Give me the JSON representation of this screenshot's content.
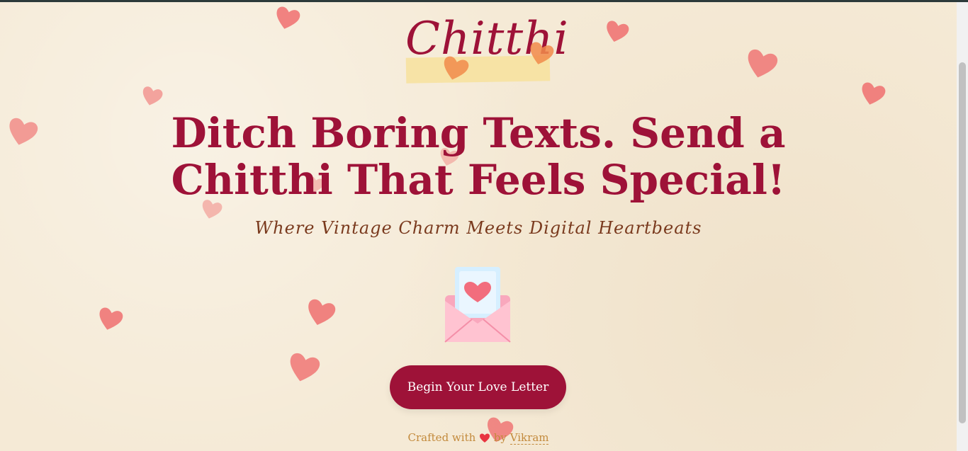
{
  "brand": {
    "name": "Chitthi"
  },
  "hero": {
    "headline_line1": "Ditch Boring Texts. Send a",
    "headline_line2": "Chitthi That Feels Special!",
    "tagline": "Where Vintage Charm Meets Digital Heartbeats"
  },
  "cta": {
    "label": "Begin Your Love Letter"
  },
  "footer": {
    "prefix": "Crafted with",
    "by": "by",
    "author": "Vikram"
  },
  "icons": {
    "envelope": "love-letter-envelope-icon",
    "heart": "heart-icon"
  },
  "colors": {
    "primary": "#9e1238",
    "background": "#f5ead6",
    "tagline": "#7a3a1e",
    "footer": "#c38a3c",
    "heart": "#f07070",
    "heart_orange": "#f28b4b"
  }
}
